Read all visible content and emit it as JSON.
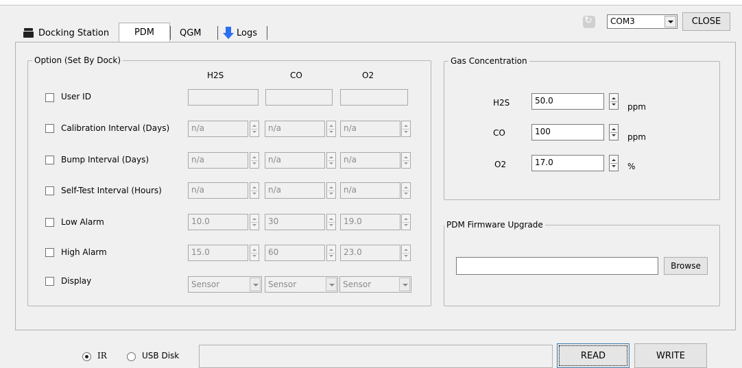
{
  "tabs": [
    {
      "label": "Docking Station"
    },
    {
      "label": "PDM"
    },
    {
      "label": "QGM"
    },
    {
      "label": "Logs"
    }
  ],
  "toolbar": {
    "com_port": "COM3",
    "close_label": "CLOSE"
  },
  "options": {
    "legend": "Option (Set By Dock)",
    "columns": [
      "H2S",
      "CO",
      "O2"
    ],
    "rows": [
      {
        "label": "User ID",
        "kind": "text",
        "values": [
          "",
          "",
          ""
        ]
      },
      {
        "label": "Calibration Interval (Days)",
        "kind": "spin",
        "values": [
          "n/a",
          "n/a",
          "n/a"
        ]
      },
      {
        "label": "Bump Interval (Days)",
        "kind": "spin",
        "values": [
          "n/a",
          "n/a",
          "n/a"
        ]
      },
      {
        "label": "Self-Test Interval (Hours)",
        "kind": "spin",
        "values": [
          "n/a",
          "n/a",
          "n/a"
        ]
      },
      {
        "label": "Low Alarm",
        "kind": "spin",
        "values": [
          "10.0",
          "30",
          "19.0"
        ]
      },
      {
        "label": "High Alarm",
        "kind": "spin",
        "values": [
          "15.0",
          "60",
          "23.0"
        ]
      },
      {
        "label": "Display",
        "kind": "select",
        "values": [
          "Sensor",
          "Sensor",
          "Sensor"
        ]
      }
    ]
  },
  "gas": {
    "legend": "Gas Concentration",
    "rows": [
      {
        "label": "H2S",
        "value": "50.0",
        "unit": "ppm"
      },
      {
        "label": "CO",
        "value": "100",
        "unit": "ppm"
      },
      {
        "label": "O2",
        "value": "17.0",
        "unit": "%"
      }
    ]
  },
  "firmware": {
    "legend": "PDM Firmware Upgrade",
    "path": "",
    "browse_label": "Browse"
  },
  "bottom": {
    "ir_label": "IR",
    "usb_label": "USB Disk",
    "status": "",
    "read_label": "READ",
    "write_label": "WRITE"
  }
}
